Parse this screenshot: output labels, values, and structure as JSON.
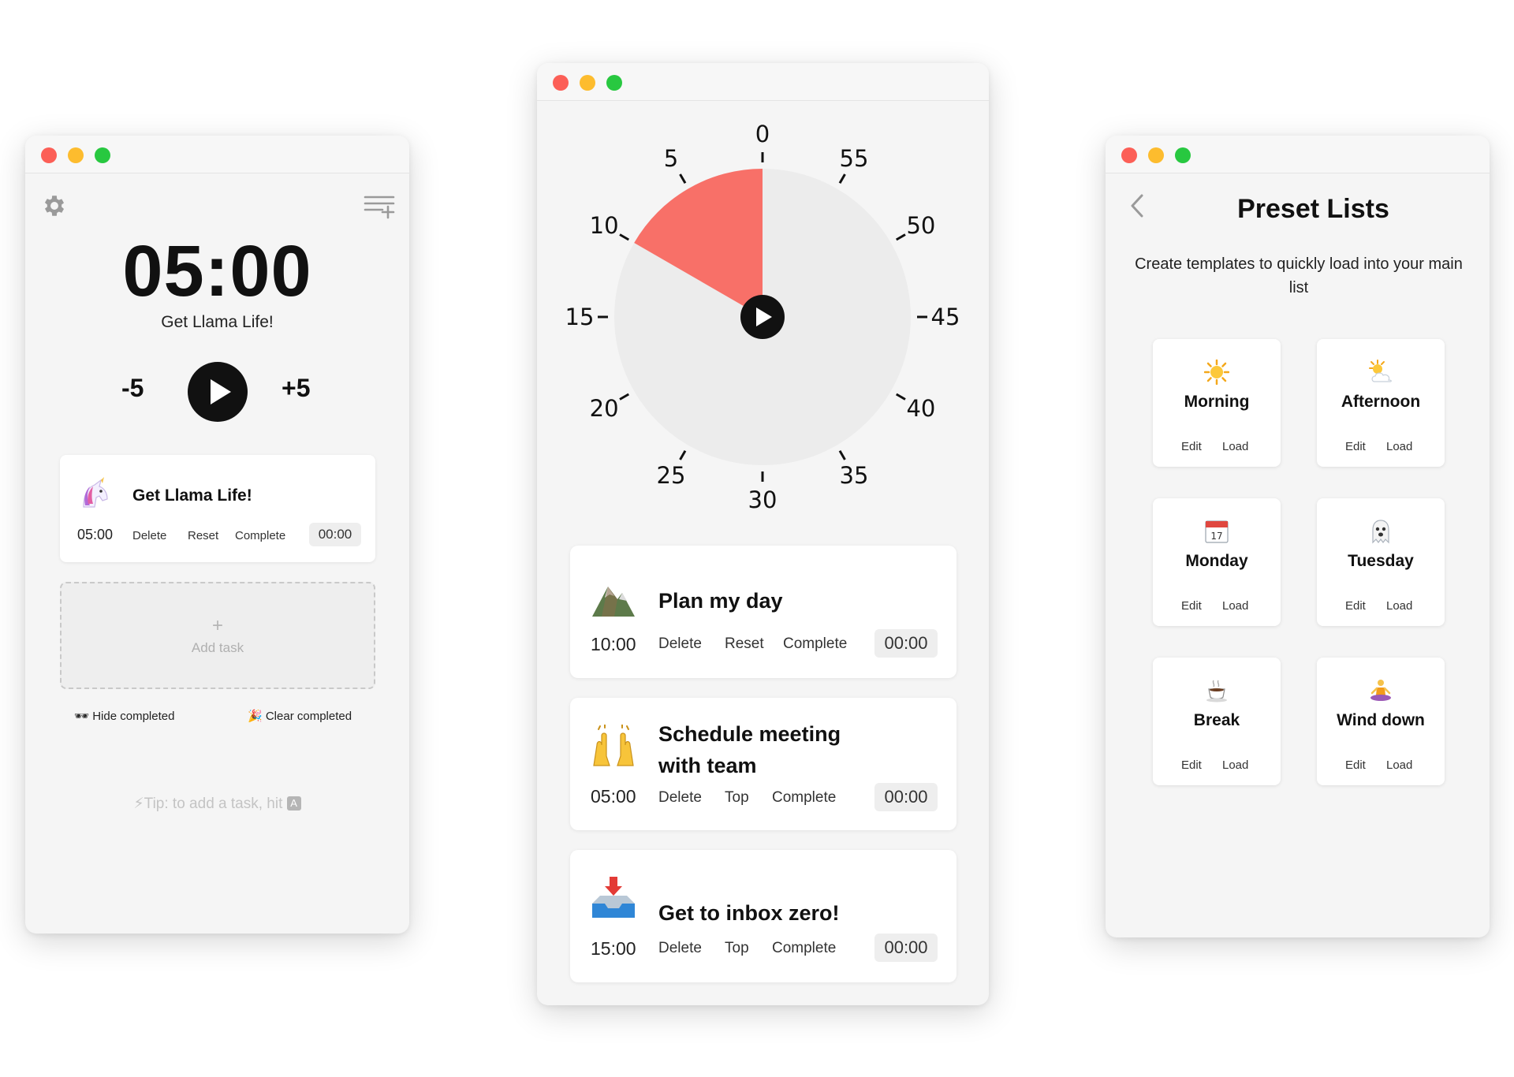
{
  "colors": {
    "accent": "#f87068",
    "dial_face": "#ececec",
    "dark": "#111111"
  },
  "window1": {
    "icons": {
      "settings": "gear-icon",
      "list_add": "list-add-icon"
    },
    "timer": "05:00",
    "current_task": "Get Llama Life!",
    "minus": "-5",
    "plus": "+5",
    "task": {
      "emoji": "unicorn-icon",
      "name": "Get Llama Life!",
      "time": "05:00",
      "actions": [
        "Delete",
        "Reset",
        "Complete"
      ],
      "elapsed": "00:00"
    },
    "add_task": {
      "plus": "+",
      "label": "Add task"
    },
    "hide_completed": "🕶 Hide completed",
    "clear_completed": "🎉 Clear completed",
    "tip_text": "⚡Tip: to add a task, hit",
    "tip_key": "A"
  },
  "window2": {
    "dial": {
      "labels": [
        "0",
        "5",
        "10",
        "15",
        "20",
        "25",
        "30",
        "35",
        "40",
        "45",
        "50",
        "55"
      ],
      "remaining_minutes": 10
    },
    "tasks": [
      {
        "emoji": "mountain-icon",
        "name": "Plan my day",
        "time": "10:00",
        "actions": [
          "Delete",
          "Reset",
          "Complete"
        ],
        "elapsed": "00:00"
      },
      {
        "emoji": "raised-hands-icon",
        "name_line1": "Schedule meeting",
        "name_line2": "with team",
        "time": "05:00",
        "actions": [
          "Delete",
          "Top",
          "Complete"
        ],
        "elapsed": "00:00"
      },
      {
        "emoji": "inbox-tray-icon",
        "name": "Get to inbox zero!",
        "time": "15:00",
        "actions": [
          "Delete",
          "Top",
          "Complete"
        ],
        "elapsed": "00:00"
      }
    ]
  },
  "window3": {
    "title": "Preset Lists",
    "description": "Create templates to quickly load into your main list",
    "presets": [
      {
        "icon": "sun-icon",
        "name": "Morning",
        "edit": "Edit",
        "load": "Load"
      },
      {
        "icon": "sun-cloud-icon",
        "name": "Afternoon",
        "edit": "Edit",
        "load": "Load"
      },
      {
        "icon": "calendar-icon",
        "name": "Monday",
        "calendar_day": "17",
        "edit": "Edit",
        "load": "Load"
      },
      {
        "icon": "ghost-icon",
        "name": "Tuesday",
        "edit": "Edit",
        "load": "Load"
      },
      {
        "icon": "coffee-icon",
        "name": "Break",
        "edit": "Edit",
        "load": "Load"
      },
      {
        "icon": "meditation-icon",
        "name": "Wind down",
        "edit": "Edit",
        "load": "Load"
      }
    ]
  }
}
